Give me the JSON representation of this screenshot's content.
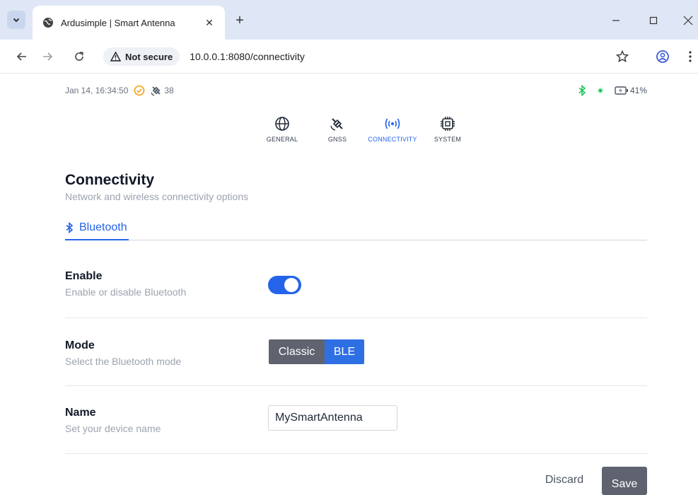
{
  "browser": {
    "tab_title": "Ardusimple | Smart Antenna",
    "tab_close": "✕",
    "new_tab": "+",
    "security_label": "Not secure",
    "url": "10.0.0.1:8080/connectivity"
  },
  "status": {
    "datetime": "Jan 14, 16:34:50",
    "satellite_count": "38",
    "battery": "41%"
  },
  "nav": {
    "items": [
      {
        "label": "GENERAL",
        "icon": "globe-icon"
      },
      {
        "label": "GNSS",
        "icon": "satellite-icon"
      },
      {
        "label": "CONNECTIVITY",
        "icon": "wireless-icon",
        "active": true
      },
      {
        "label": "SYSTEM",
        "icon": "cpu-icon"
      }
    ]
  },
  "page": {
    "title": "Connectivity",
    "subtitle": "Network and wireless connectivity options",
    "tab": "Bluetooth"
  },
  "settings": {
    "enable": {
      "label": "Enable",
      "desc": "Enable or disable Bluetooth",
      "value": true
    },
    "mode": {
      "label": "Mode",
      "desc": "Select the Bluetooth mode",
      "options": [
        "Classic",
        "BLE"
      ],
      "selected": "BLE"
    },
    "name": {
      "label": "Name",
      "desc": "Set your device name",
      "value": "MySmartAntenna"
    }
  },
  "actions": {
    "discard": "Discard",
    "save": "Save"
  },
  "colors": {
    "accent": "#2563eb",
    "status_ok": "#22c55e",
    "location_ok": "#f59e0b"
  }
}
